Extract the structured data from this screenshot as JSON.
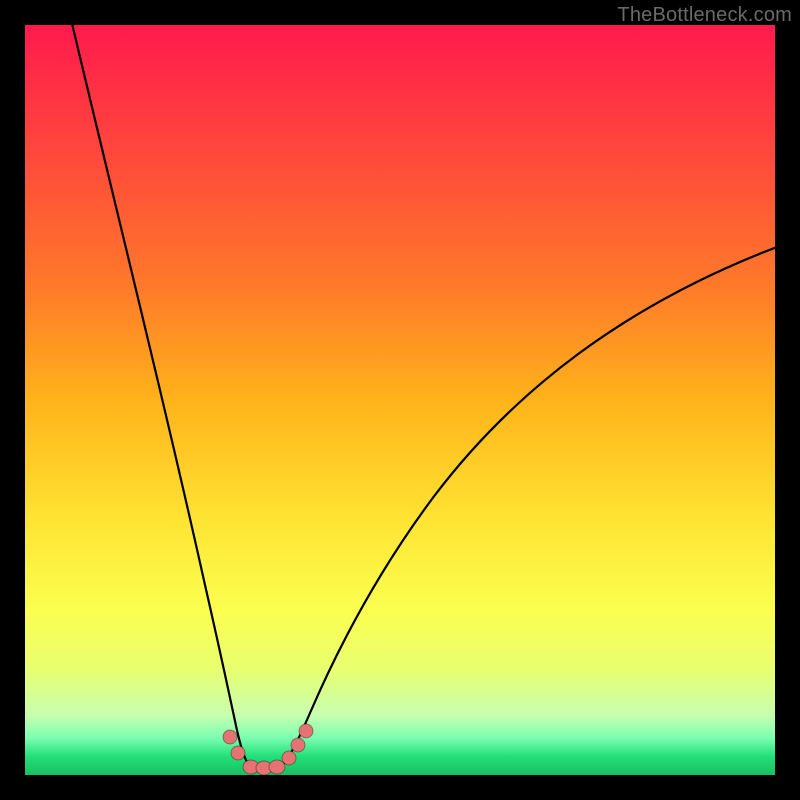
{
  "watermark": "TheBottleneck.com",
  "chart_data": {
    "type": "line",
    "title": "",
    "xlabel": "",
    "ylabel": "",
    "xlim": [
      0,
      100
    ],
    "ylim": [
      0,
      100
    ],
    "curve_left": {
      "description": "Steeply falling branch entering from top-left, bottoming near x≈30",
      "x": [
        6,
        10,
        15,
        20,
        24,
        26,
        27.5,
        29,
        30
      ],
      "y": [
        100,
        80,
        55,
        30,
        12,
        6,
        3,
        1.2,
        0.6
      ]
    },
    "curve_right": {
      "description": "Rising branch from the trough toward upper-right",
      "x": [
        33,
        35,
        38,
        43,
        50,
        60,
        72,
        85,
        98,
        100
      ],
      "y": [
        0.6,
        1.6,
        4,
        10,
        20,
        34,
        48,
        60,
        69,
        70
      ]
    },
    "trough": {
      "x_range": [
        29,
        34
      ],
      "y": 0.5
    },
    "scatter_points": [
      {
        "x": 27.0,
        "y": 4.6
      },
      {
        "x": 28.0,
        "y": 2.4
      },
      {
        "x": 30.0,
        "y": 0.9
      },
      {
        "x": 31.7,
        "y": 0.9
      },
      {
        "x": 33.4,
        "y": 0.9
      },
      {
        "x": 35.0,
        "y": 2.0
      },
      {
        "x": 36.3,
        "y": 3.8
      },
      {
        "x": 37.3,
        "y": 5.6
      }
    ],
    "colors": {
      "scatter": "#e57373",
      "curve": "#000000",
      "gradient_top": "#ff1a4d",
      "gradient_mid": "#ffe433",
      "gradient_bottom": "#1abf63"
    }
  }
}
